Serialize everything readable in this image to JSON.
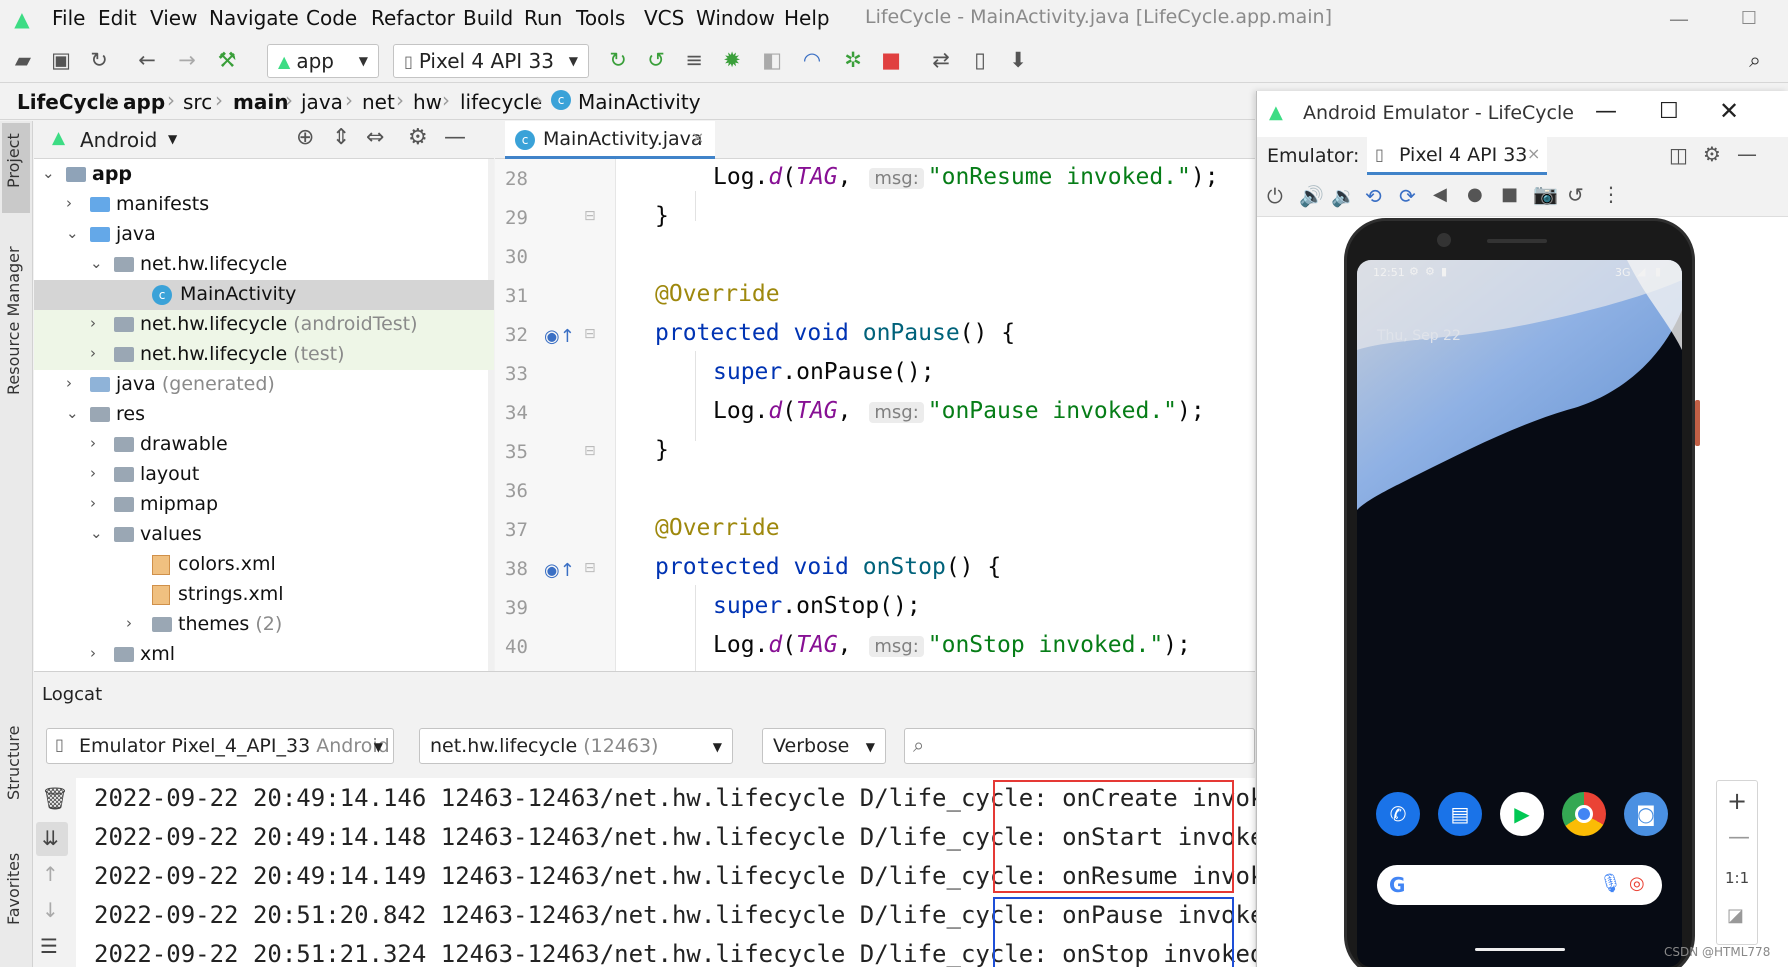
{
  "menu": [
    "File",
    "Edit",
    "View",
    "Navigate",
    "Code",
    "Refactor",
    "Build",
    "Run",
    "Tools",
    "VCS",
    "Window",
    "Help"
  ],
  "window_title": "LifeCycle - MainActivity.java [LifeCycle.app.main]",
  "toolbar": {
    "run_config": "app",
    "device": "Pixel 4 API 33"
  },
  "breadcrumb": [
    "LifeCycle",
    "app",
    "src",
    "main",
    "java",
    "net",
    "hw",
    "lifecycle",
    "MainActivity"
  ],
  "side_tabs": {
    "project": "Project",
    "resource_manager": "Resource Manager",
    "structure": "Structure",
    "favorites": "Favorites"
  },
  "project_panel": {
    "view": "Android"
  },
  "tree": [
    {
      "label": "app",
      "suffix": ""
    },
    {
      "label": "manifests",
      "suffix": ""
    },
    {
      "label": "java",
      "suffix": ""
    },
    {
      "label": "net.hw.lifecycle",
      "suffix": ""
    },
    {
      "label": "MainActivity",
      "suffix": ""
    },
    {
      "label": "net.hw.lifecycle",
      "suffix": "(androidTest)"
    },
    {
      "label": "net.hw.lifecycle",
      "suffix": "(test)"
    },
    {
      "label": "java",
      "suffix": "(generated)"
    },
    {
      "label": "res",
      "suffix": ""
    },
    {
      "label": "drawable",
      "suffix": ""
    },
    {
      "label": "layout",
      "suffix": ""
    },
    {
      "label": "mipmap",
      "suffix": ""
    },
    {
      "label": "values",
      "suffix": ""
    },
    {
      "label": "colors.xml",
      "suffix": ""
    },
    {
      "label": "strings.xml",
      "suffix": ""
    },
    {
      "label": "themes",
      "suffix": "(2)"
    },
    {
      "label": "xml",
      "suffix": ""
    }
  ],
  "editor": {
    "tab": "MainActivity.java",
    "line_numbers": [
      "28",
      "29",
      "30",
      "31",
      "32",
      "33",
      "34",
      "35",
      "36",
      "37",
      "38",
      "39",
      "40"
    ],
    "hint_label": "msg:",
    "resume_log": "\"onResume invoked.\"",
    "pause_log": "\"onPause invoked.\"",
    "stop_log": "\"onStop invoked.\""
  },
  "logcat": {
    "title": "Logcat",
    "device": "Emulator Pixel_4_API_33",
    "device_suffix": "Android",
    "package": "net.hw.lifecycle",
    "package_pid": "(12463)",
    "level": "Verbose",
    "lines": [
      {
        "prefix": "2022-09-22 20:49:14.146 12463-12463/net.hw.lifecycle D/life_cycle:",
        "msg": "onCreate invoked."
      },
      {
        "prefix": "2022-09-22 20:49:14.148 12463-12463/net.hw.lifecycle D/life_cycle:",
        "msg": "onStart invoked."
      },
      {
        "prefix": "2022-09-22 20:49:14.149 12463-12463/net.hw.lifecycle D/life_cycle:",
        "msg": "onResume invoked."
      },
      {
        "prefix": "2022-09-22 20:51:20.842 12463-12463/net.hw.lifecycle D/life_cycle:",
        "msg": "onPause invoked."
      },
      {
        "prefix": "2022-09-22 20:51:21.324 12463-12463/net.hw.lifecycle D/life_cycle:",
        "msg": "onStop invoked."
      }
    ],
    "highlight_colors": {
      "first_group": "#e53935",
      "second_group": "#1e4fd8"
    }
  },
  "emulator": {
    "title": "Android Emulator - LifeCycle",
    "label": "Emulator:",
    "device": "Pixel 4 API 33",
    "status_time": "12:51",
    "status_net": "3G",
    "date": "Thu, Sep 22",
    "zoom_ratio": "1:1"
  },
  "watermark": "CSDN @HTML778",
  "colors": {
    "android_green": "#3ddc84",
    "keyword": "#0033b3",
    "string": "#067d17",
    "annotation": "#9e880d"
  }
}
